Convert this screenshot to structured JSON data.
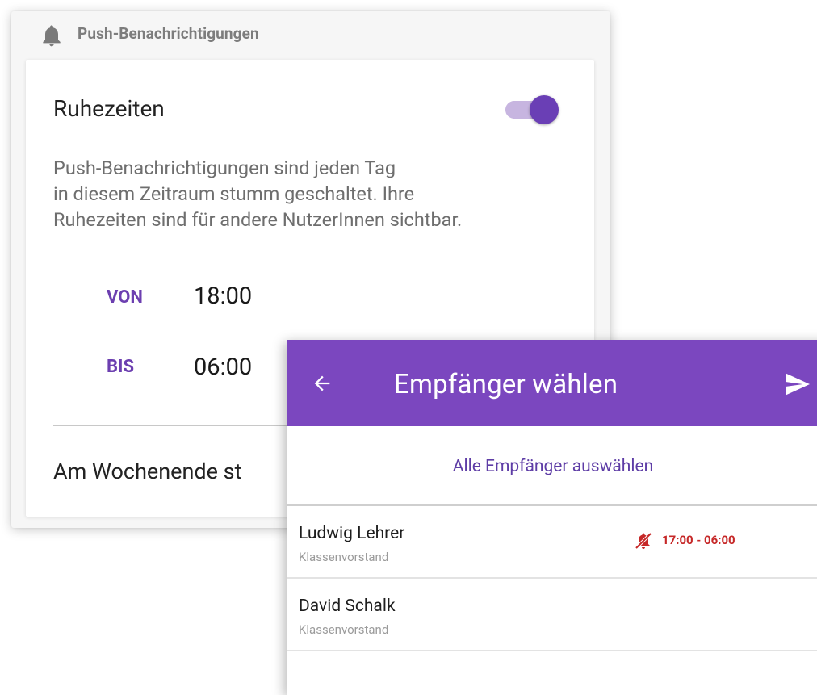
{
  "settings": {
    "section_title": "Push-Benachrichtigungen",
    "section_icon": "bell-icon",
    "quiet_hours": {
      "title": "Ruhezeiten",
      "enabled": true,
      "description_lines": [
        "Push-Benachrichtigungen sind jeden Tag",
        "in diesem Zeitraum stumm geschaltet. Ihre",
        "Ruhezeiten sind für andere NutzerInnen sichtbar."
      ],
      "from_label": "VON",
      "from_value": "18:00",
      "to_label": "BIS",
      "to_value": "06:00"
    },
    "weekend_label": "Am Wochenende st"
  },
  "recipient_picker": {
    "title": "Empfänger wählen",
    "back_icon": "arrow-left-icon",
    "send_icon": "send-icon",
    "select_all_label": "Alle Empfänger auswählen",
    "recipients": [
      {
        "name": "Ludwig Lehrer",
        "role": "Klassenvorstand",
        "quiet_hours": "17:00 - 06:00",
        "quiet_icon": "muted-bell-icon"
      },
      {
        "name": "David Schalk",
        "role": "Klassenvorstand"
      }
    ]
  },
  "colors": {
    "accent": "#7b47bf",
    "accent_dark": "#6a3fb5",
    "toggle_track": "#c7b5e0",
    "label_purple": "#6c3fb0",
    "muted_red": "#c62828",
    "panel_background": "#f6f6f6"
  }
}
